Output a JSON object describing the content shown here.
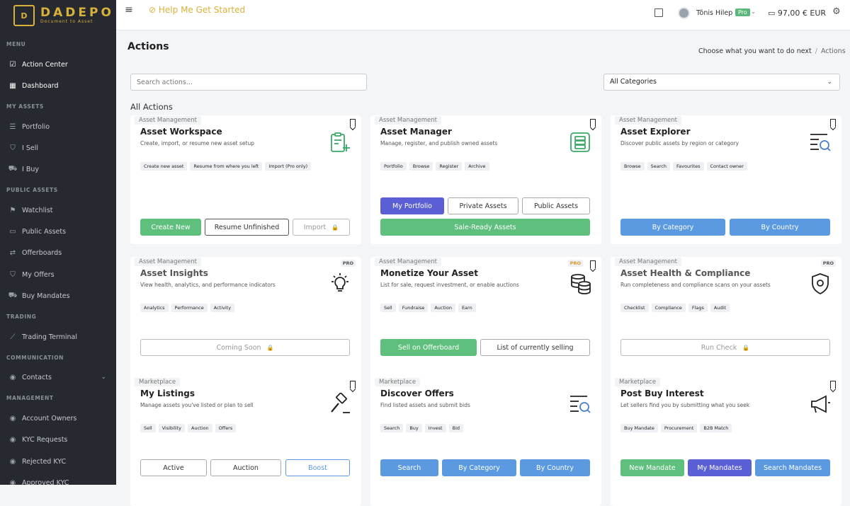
{
  "brand": {
    "name": "DADEPO",
    "tagline": "Document to Asset",
    "mark": "D"
  },
  "sidebar": {
    "menu_label": "MENU",
    "my_assets_label": "MY ASSETS",
    "public_assets_label": "PUBLIC ASSETS",
    "trading_label": "TRADING",
    "communication_label": "COMMUNICATION",
    "management_label": "MANAGEMENT",
    "items": {
      "action_center": "Action Center",
      "dashboard": "Dashboard",
      "portfolio": "Portfolio",
      "i_sell": "I Sell",
      "i_buy": "I Buy",
      "watchlist": "Watchlist",
      "public_assets": "Public Assets",
      "offerboards": "Offerboards",
      "my_offers": "My Offers",
      "buy_mandates": "Buy Mandates",
      "trading_terminal": "Trading Terminal",
      "contacts": "Contacts",
      "account_owners": "Account Owners",
      "kyc_requests": "KYC Requests",
      "rejected_kyc": "Rejected KYC",
      "approved_kyc": "Approved KYC"
    }
  },
  "topbar": {
    "help": "Help Me Get Started",
    "user": "Tõnis Hilep",
    "plan": "Pro",
    "balance": "97,00 € EUR"
  },
  "page": {
    "title": "Actions",
    "crumb_root": "Choose what you want to do next",
    "crumb_sep": "/",
    "crumb_current": "Actions",
    "search_placeholder": "Search actions...",
    "category": "All Categories",
    "section": "All Actions"
  },
  "cards": [
    {
      "category": "Asset Management",
      "title": "Asset Workspace",
      "desc": "Create, import, or resume new asset setup",
      "tags": [
        "Create new asset",
        "Resume from where you left",
        "Import (Pro only)"
      ],
      "buttons": [
        "Create New",
        "Resume Unfinished",
        "Import"
      ]
    },
    {
      "category": "Asset Management",
      "title": "Asset Manager",
      "desc": "Manage, register, and publish owned assets",
      "tags": [
        "Portfolio",
        "Browse",
        "Register",
        "Archive"
      ],
      "buttons": [
        "My Portfolio",
        "Private Assets",
        "Public Assets",
        "Sale-Ready Assets"
      ]
    },
    {
      "category": "Asset Management",
      "title": "Asset Explorer",
      "desc": "Discover public assets by region or category",
      "tags": [
        "Browse",
        "Search",
        "Favourites",
        "Contact owner"
      ],
      "buttons": [
        "By Category",
        "By Country"
      ]
    },
    {
      "category": "Asset Management",
      "title": "Asset Insights",
      "desc": "View health, analytics, and performance indicators",
      "badge": "PRO",
      "tags": [
        "Analytics",
        "Performance",
        "Activity"
      ],
      "buttons": [
        "Coming Soon"
      ]
    },
    {
      "category": "Asset Management",
      "title": "Monetize Your Asset",
      "desc": "List for sale, request investment, or enable auctions",
      "badge": "PRO",
      "tags": [
        "Sell",
        "Fundraise",
        "Auction",
        "Earn"
      ],
      "buttons": [
        "Sell on Offerboard",
        "List of currently selling"
      ]
    },
    {
      "category": "Asset Management",
      "title": "Asset Health & Compliance",
      "desc": "Run completeness and compliance scans on your assets",
      "badge": "PRO",
      "tags": [
        "Checklist",
        "Compliance",
        "Flags",
        "Audit"
      ],
      "buttons": [
        "Run Check"
      ]
    },
    {
      "category": "Marketplace",
      "title": "My Listings",
      "desc": "Manage assets you've listed or plan to sell",
      "tags": [
        "Sell",
        "Visibility",
        "Auction",
        "Offers"
      ],
      "buttons": [
        "Active",
        "Auction",
        "Boost"
      ]
    },
    {
      "category": "Marketplace",
      "title": "Discover Offers",
      "desc": "Find listed assets and submit bids",
      "tags": [
        "Search",
        "Buy",
        "Invest",
        "Bid"
      ],
      "buttons": [
        "Search",
        "By Category",
        "By Country"
      ]
    },
    {
      "category": "Marketplace",
      "title": "Post Buy Interest",
      "desc": "Let sellers find you by submitting what you seek",
      "tags": [
        "Buy Mandate",
        "Procurement",
        "B2B Match"
      ],
      "buttons": [
        "New Mandate",
        "My Mandates",
        "Search Mandates"
      ]
    }
  ]
}
